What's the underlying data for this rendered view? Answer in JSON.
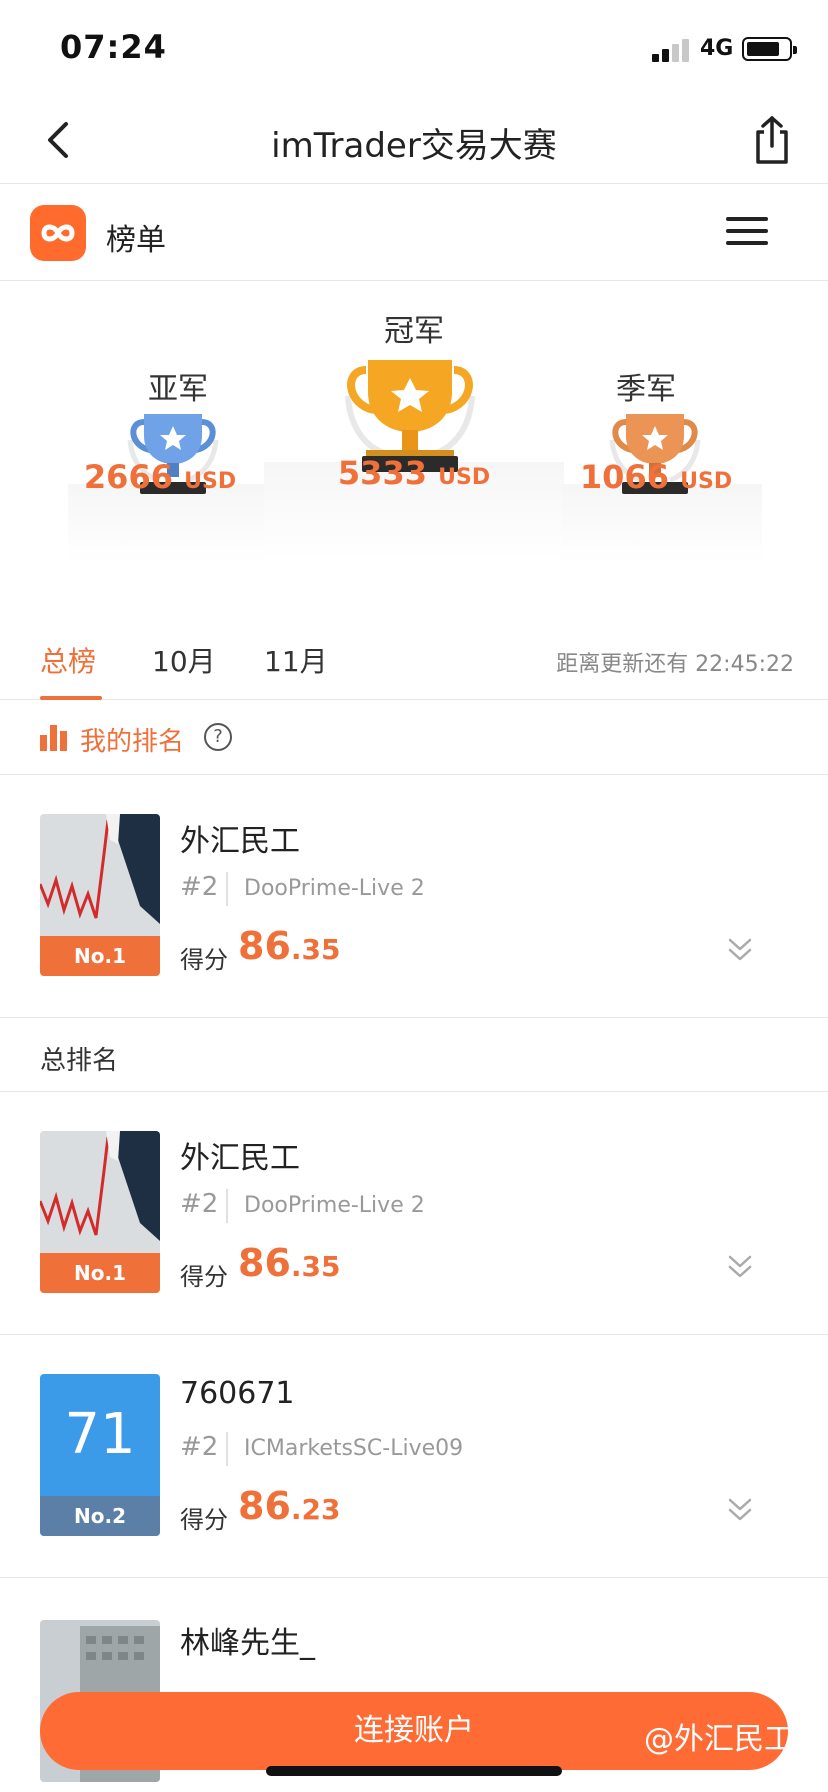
{
  "status_bar": {
    "time": "07:24",
    "network": "4G"
  },
  "nav": {
    "title": "imTrader交易大赛"
  },
  "board": {
    "title": "榜单"
  },
  "podium": {
    "champion": {
      "label": "冠军",
      "amount": "5333",
      "unit": "USD"
    },
    "runner_up": {
      "label": "亚军",
      "amount": "2666",
      "unit": "USD"
    },
    "third": {
      "label": "季军",
      "amount": "1066",
      "unit": "USD"
    }
  },
  "tabs": [
    {
      "label": "总榜",
      "active": true
    },
    {
      "label": "10月",
      "active": false
    },
    {
      "label": "11月",
      "active": false
    }
  ],
  "countdown": "距离更新还有 22:45:22",
  "my_rank": {
    "title": "我的排名",
    "help": "?"
  },
  "my_card": {
    "name": "外汇民工",
    "badge": "No.1",
    "rank": "#2",
    "server": "DooPrime-Live 2",
    "score_label": "得分",
    "score_int": "86",
    "score_dec": ".35"
  },
  "overall_section": {
    "title": "总排名"
  },
  "entries": [
    {
      "name": "外汇民工",
      "badge": "No.1",
      "rank": "#2",
      "server": "DooPrime-Live 2",
      "score_label": "得分",
      "score_int": "86",
      "score_dec": ".35"
    },
    {
      "name": "760671",
      "avatar_text": "71",
      "badge": "No.2",
      "rank": "#2",
      "server": "ICMarketsSC-Live09",
      "score_label": "得分",
      "score_int": "86",
      "score_dec": ".23"
    },
    {
      "name": "林峰先生_"
    }
  ],
  "connect_button": "连接账户",
  "watermark": "@外汇民工",
  "colors": {
    "accent": "#f0703a",
    "button": "#ff6b35",
    "gold": "#f5a623",
    "silver": "#5b8fd6",
    "bronze": "#e08a48"
  }
}
